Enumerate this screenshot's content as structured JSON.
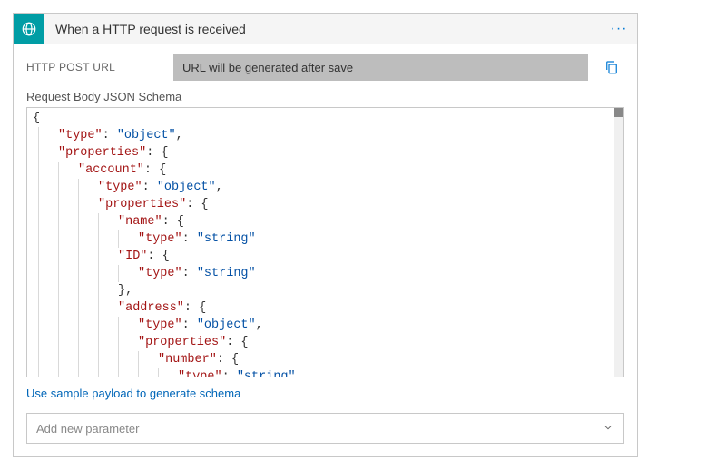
{
  "header": {
    "title": "When a HTTP request is received",
    "icon": "globe-icon",
    "menu_label": "···"
  },
  "url_section": {
    "label": "HTTP POST URL",
    "value": "URL will be generated after save"
  },
  "schema_section": {
    "label": "Request Body JSON Schema",
    "code_lines": [
      [
        {
          "t": "punc",
          "v": "{"
        }
      ],
      [
        {
          "t": "indent",
          "n": 1
        },
        {
          "t": "key",
          "v": "\"type\""
        },
        {
          "t": "punc",
          "v": ": "
        },
        {
          "t": "str",
          "v": "\"object\""
        },
        {
          "t": "punc",
          "v": ","
        }
      ],
      [
        {
          "t": "indent",
          "n": 1
        },
        {
          "t": "key",
          "v": "\"properties\""
        },
        {
          "t": "punc",
          "v": ": {"
        }
      ],
      [
        {
          "t": "indent",
          "n": 2
        },
        {
          "t": "key",
          "v": "\"account\""
        },
        {
          "t": "punc",
          "v": ": {"
        }
      ],
      [
        {
          "t": "indent",
          "n": 3
        },
        {
          "t": "key",
          "v": "\"type\""
        },
        {
          "t": "punc",
          "v": ": "
        },
        {
          "t": "str",
          "v": "\"object\""
        },
        {
          "t": "punc",
          "v": ","
        }
      ],
      [
        {
          "t": "indent",
          "n": 3
        },
        {
          "t": "key",
          "v": "\"properties\""
        },
        {
          "t": "punc",
          "v": ": {"
        }
      ],
      [
        {
          "t": "indent",
          "n": 4
        },
        {
          "t": "key",
          "v": "\"name\""
        },
        {
          "t": "punc",
          "v": ": {"
        }
      ],
      [
        {
          "t": "indent",
          "n": 5
        },
        {
          "t": "key",
          "v": "\"type\""
        },
        {
          "t": "punc",
          "v": ": "
        },
        {
          "t": "str",
          "v": "\"string\""
        }
      ],
      [
        {
          "t": "indent",
          "n": 4
        },
        {
          "t": "key",
          "v": "\"ID\""
        },
        {
          "t": "punc",
          "v": ": {"
        }
      ],
      [
        {
          "t": "indent",
          "n": 5
        },
        {
          "t": "key",
          "v": "\"type\""
        },
        {
          "t": "punc",
          "v": ": "
        },
        {
          "t": "str",
          "v": "\"string\""
        }
      ],
      [
        {
          "t": "indent",
          "n": 4
        },
        {
          "t": "punc",
          "v": "},"
        }
      ],
      [
        {
          "t": "indent",
          "n": 4
        },
        {
          "t": "key",
          "v": "\"address\""
        },
        {
          "t": "punc",
          "v": ": {"
        }
      ],
      [
        {
          "t": "indent",
          "n": 5
        },
        {
          "t": "key",
          "v": "\"type\""
        },
        {
          "t": "punc",
          "v": ": "
        },
        {
          "t": "str",
          "v": "\"object\""
        },
        {
          "t": "punc",
          "v": ","
        }
      ],
      [
        {
          "t": "indent",
          "n": 5
        },
        {
          "t": "key",
          "v": "\"properties\""
        },
        {
          "t": "punc",
          "v": ": {"
        }
      ],
      [
        {
          "t": "indent",
          "n": 6
        },
        {
          "t": "key",
          "v": "\"number\""
        },
        {
          "t": "punc",
          "v": ": {"
        }
      ],
      [
        {
          "t": "indent",
          "n": 7
        },
        {
          "t": "key",
          "v": "\"type\""
        },
        {
          "t": "punc",
          "v": ": "
        },
        {
          "t": "str",
          "v": "\"string\""
        }
      ]
    ]
  },
  "sample_link": "Use sample payload to generate schema",
  "param_select": {
    "placeholder": "Add new parameter"
  },
  "colors": {
    "brand": "#009da5",
    "link": "#0066b8"
  }
}
